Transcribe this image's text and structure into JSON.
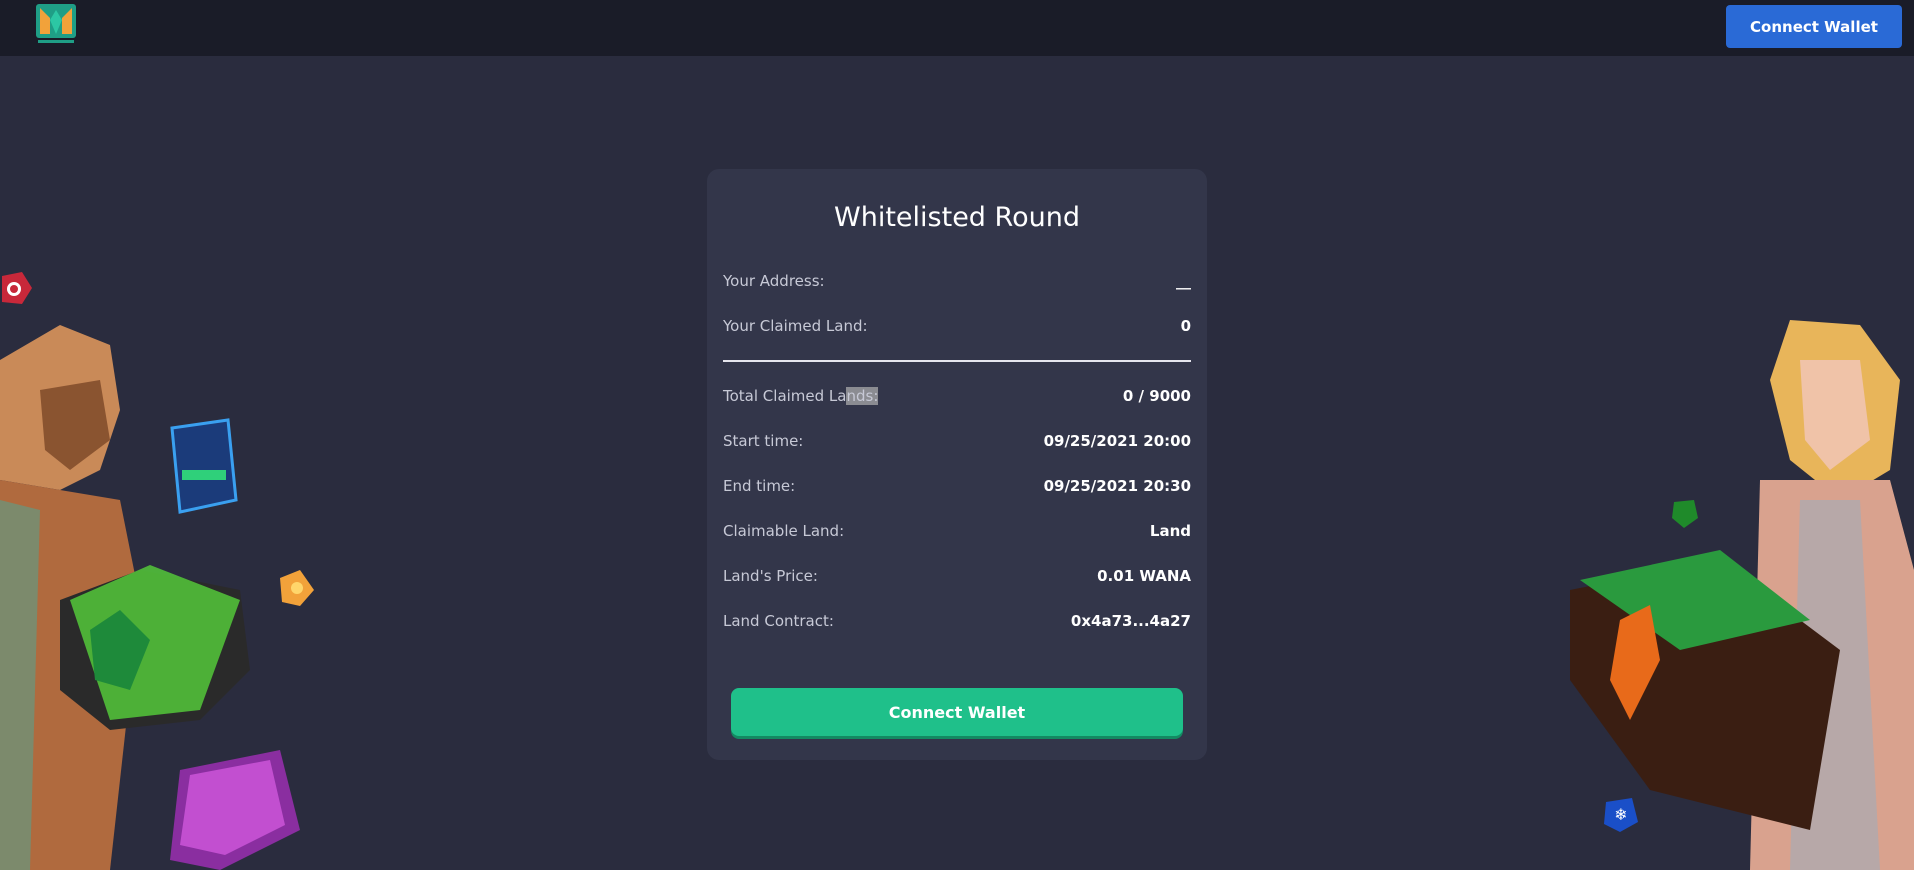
{
  "header": {
    "connect_label": "Connect Wallet"
  },
  "card": {
    "title": "Whitelisted Round",
    "rows_top": [
      {
        "label": "Your Address:",
        "value": "__"
      },
      {
        "label": "Your Claimed Land:",
        "value": "0"
      }
    ],
    "rows_bottom": [
      {
        "label_pre": "Total Claimed La",
        "label_hl": "nds:",
        "value": "0 / 9000"
      },
      {
        "label": "Start time:",
        "value": "09/25/2021 20:00"
      },
      {
        "label": "End time:",
        "value": "09/25/2021 20:30"
      },
      {
        "label": "Claimable Land:",
        "value": "Land"
      },
      {
        "label": "Land's Price:",
        "value": "0.01 WANA"
      },
      {
        "label": "Land Contract:",
        "value": "0x4a73...4a27"
      }
    ],
    "connect_label": "Connect Wallet"
  },
  "colors": {
    "background": "#2a2c3e",
    "topbar": "#1a1c28",
    "card": "#33364a",
    "primary_button": "#2a6ad6",
    "accent_button": "#1fc08a"
  }
}
